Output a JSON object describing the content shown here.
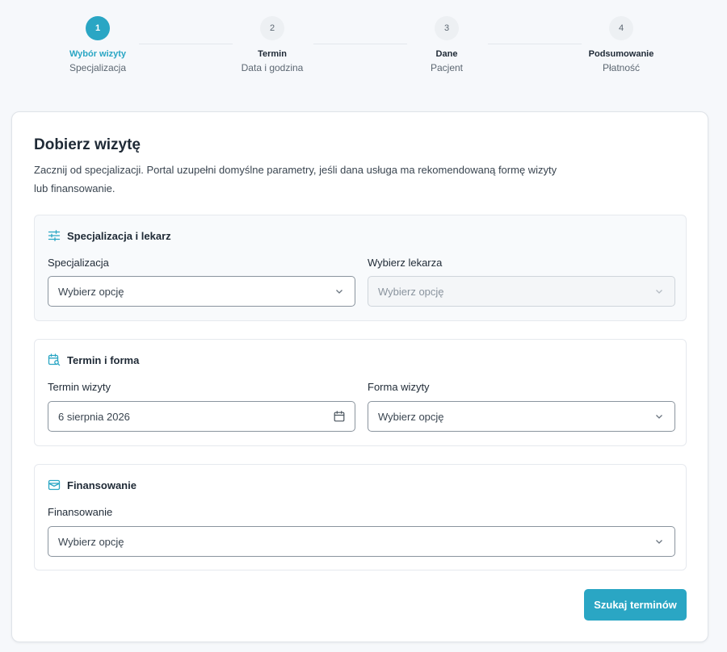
{
  "stepper": {
    "steps": [
      {
        "number": "1",
        "title": "Wybór wizyty",
        "subtitle": "Specjalizacja"
      },
      {
        "number": "2",
        "title": "Termin",
        "subtitle": "Data i godzina"
      },
      {
        "number": "3",
        "title": "Dane",
        "subtitle": "Pacjent"
      },
      {
        "number": "4",
        "title": "Podsumowanie",
        "subtitle": "Płatność"
      }
    ],
    "active_step": 1
  },
  "form": {
    "title": "Dobierz wizytę",
    "intro": "Zacznij od specjalizacji. Portal uzupełni domyślne parametry, jeśli dana usługa ma rekomendowaną formę wizyty lub finansowanie.",
    "sections": {
      "specialization": {
        "heading": "Specjalizacja i lekarz",
        "specialization_label": "Specjalizacja",
        "specialization_value": "Wybierz opcję",
        "doctor_label": "Wybierz lekarza",
        "doctor_value": "Wybierz opcję"
      },
      "term": {
        "heading": "Termin i forma",
        "date_label": "Termin wizyty",
        "date_value": "6 sierpnia 2026",
        "form_label": "Forma wizyty",
        "form_value": "Wybierz opcję"
      },
      "financing": {
        "heading": "Finansowanie",
        "financing_label": "Finansowanie",
        "financing_value": "Wybierz opcję"
      }
    },
    "search_button": "Szukaj terminów"
  },
  "colors": {
    "accent": "#2aa6c4",
    "background": "#f6f8fb",
    "text": "#1f2a36"
  },
  "icons": [
    "sliders-icon",
    "calendar-search-icon",
    "wallet-icon",
    "chevron-down-icon",
    "calendar-icon"
  ]
}
